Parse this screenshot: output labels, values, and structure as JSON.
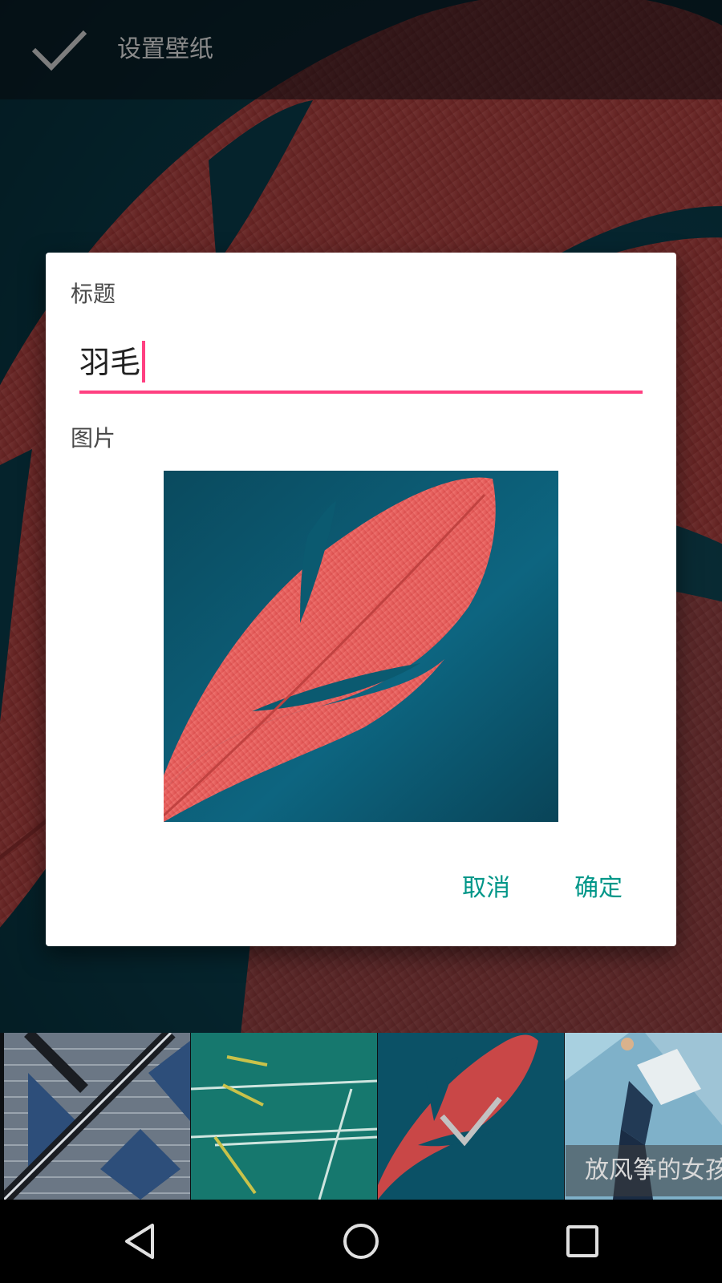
{
  "action_bar": {
    "title": "设置壁纸",
    "confirm_icon": "check-icon"
  },
  "dialog": {
    "title_label": "标题",
    "title_value": "羽毛",
    "image_label": "图片",
    "cancel_label": "取消",
    "ok_label": "确定"
  },
  "thumbnails": {
    "items": [
      {
        "id": "diagonal-architecture",
        "selected": false
      },
      {
        "id": "court-lines",
        "selected": false
      },
      {
        "id": "red-feather",
        "selected": true
      },
      {
        "id": "kite-girl",
        "selected": false
      }
    ],
    "caption": "放风筝的女孩"
  },
  "navbar": {
    "back_icon": "back-triangle-icon",
    "home_icon": "home-circle-icon",
    "recents_icon": "recents-square-icon"
  },
  "colors": {
    "accent": "#ff4081",
    "button_text": "#009688",
    "feather": "#e8595a",
    "teal_bg": "#0b4a5d"
  }
}
